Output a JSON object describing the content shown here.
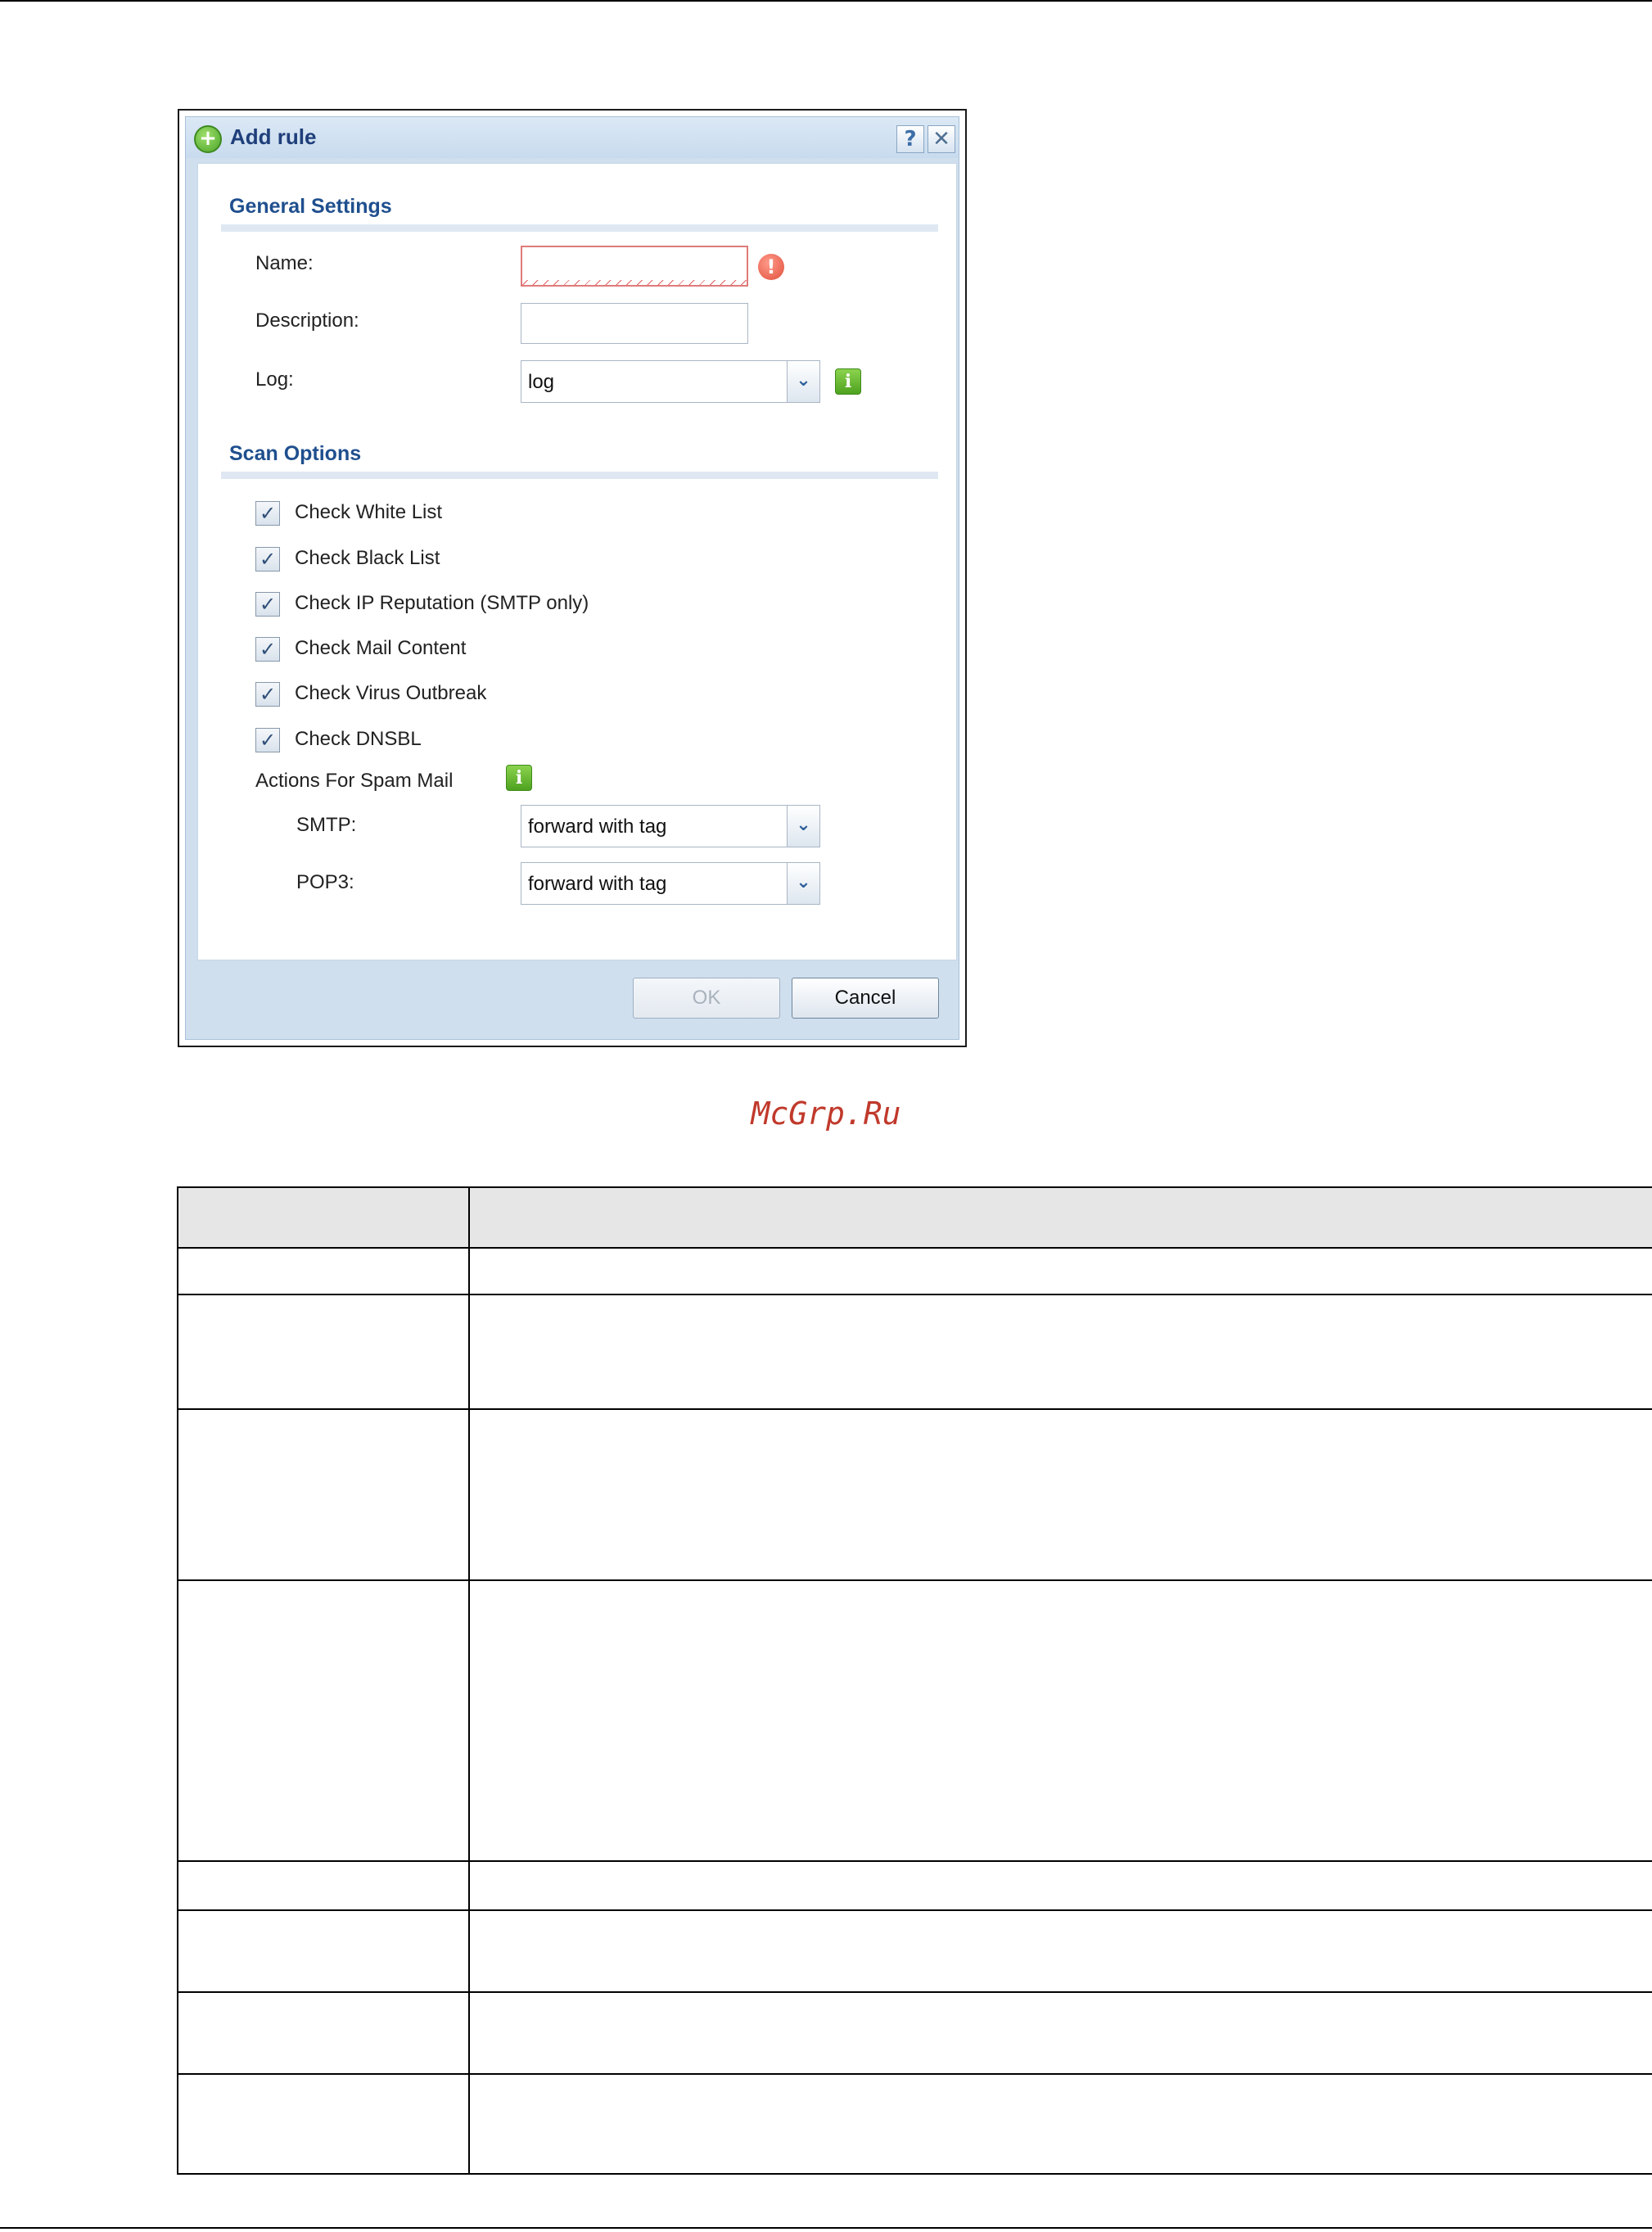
{
  "dialog": {
    "title": "Add rule",
    "help_icon": "question-icon",
    "close_icon": "close-icon",
    "general_settings": {
      "heading": "General Settings",
      "name_label": "Name:",
      "name_value": "",
      "description_label": "Description:",
      "description_value": "",
      "log_label": "Log:",
      "log_value": "log"
    },
    "scan_options": {
      "heading": "Scan Options",
      "checks": [
        {
          "label": "Check White List",
          "checked": true
        },
        {
          "label": "Check Black List",
          "checked": true
        },
        {
          "label": "Check IP Reputation (SMTP only)",
          "checked": true
        },
        {
          "label": "Check Mail Content",
          "checked": true
        },
        {
          "label": "Check Virus Outbreak",
          "checked": true
        },
        {
          "label": "Check DNSBL",
          "checked": true
        }
      ],
      "actions_label": "Actions For Spam Mail",
      "smtp_label": "SMTP:",
      "smtp_value": "forward with tag",
      "pop3_label": "POP3:",
      "pop3_value": "forward with tag"
    },
    "buttons": {
      "ok": "OK",
      "cancel": "Cancel"
    }
  },
  "watermark": "McGrp.Ru",
  "colors": {
    "title_text": "#1f3f7a",
    "section_heading": "#1f4f8e",
    "dialog_bg": "#cfdfee",
    "watermark": "#c0392b"
  }
}
